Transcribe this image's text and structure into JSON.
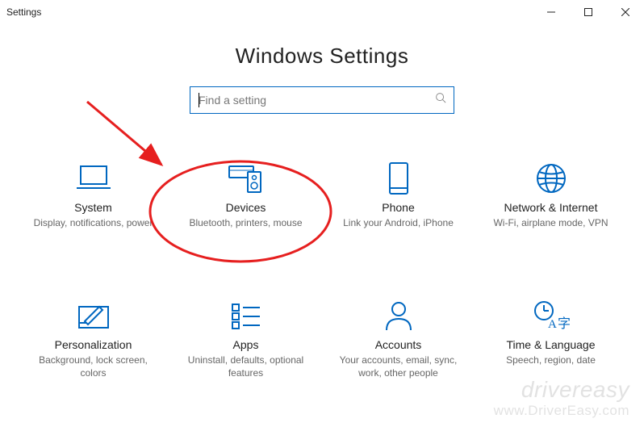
{
  "window": {
    "title": "Settings"
  },
  "page": {
    "title": "Windows Settings"
  },
  "search": {
    "placeholder": "Find a setting",
    "value": ""
  },
  "tiles": [
    {
      "key": "system",
      "label": "System",
      "desc": "Display, notifications, power"
    },
    {
      "key": "devices",
      "label": "Devices",
      "desc": "Bluetooth, printers, mouse"
    },
    {
      "key": "phone",
      "label": "Phone",
      "desc": "Link your Android, iPhone"
    },
    {
      "key": "network",
      "label": "Network & Internet",
      "desc": "Wi-Fi, airplane mode, VPN"
    },
    {
      "key": "personalization",
      "label": "Personalization",
      "desc": "Background, lock screen, colors"
    },
    {
      "key": "apps",
      "label": "Apps",
      "desc": "Uninstall, defaults, optional features"
    },
    {
      "key": "accounts",
      "label": "Accounts",
      "desc": "Your accounts, email, sync, work, other people"
    },
    {
      "key": "time",
      "label": "Time & Language",
      "desc": "Speech, region, date"
    }
  ],
  "annotation": {
    "highlight_tile": "devices",
    "color": "#e61f1f"
  },
  "watermark": {
    "line1": "drivereasy",
    "line2": "www.DriverEasy.com"
  }
}
